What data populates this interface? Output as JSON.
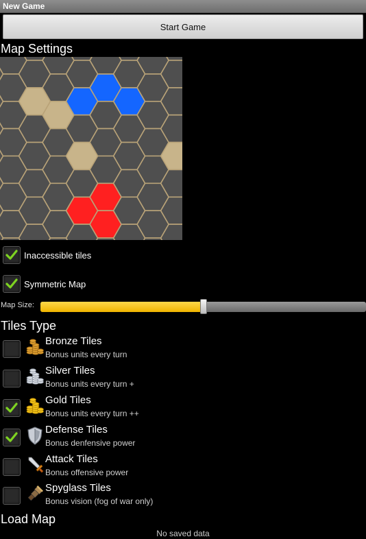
{
  "window": {
    "title": "New Game"
  },
  "start_button": {
    "label": "Start Game"
  },
  "map_settings": {
    "heading": "Map Settings",
    "colors": {
      "empty": "#4f4f4f",
      "grid": "#b9a378",
      "sand": "#c8b48a",
      "blue": "#1466ff",
      "red": "#ff2020"
    }
  },
  "options": [
    {
      "label": "Inaccessible tiles",
      "checked": true
    },
    {
      "label": "Symmetric Map",
      "checked": true
    }
  ],
  "map_size": {
    "label": "Map Size:",
    "value": 0.5
  },
  "tiles_type": {
    "heading": "Tiles Type",
    "items": [
      {
        "name": "Bronze Tiles",
        "description": "Bonus units every turn",
        "icon": "bronze-coins-icon",
        "checked": false
      },
      {
        "name": "Silver Tiles",
        "description": "Bonus units every turn +",
        "icon": "silver-coins-icon",
        "checked": false
      },
      {
        "name": "Gold Tiles",
        "description": "Bonus units every turn ++",
        "icon": "gold-coins-icon",
        "checked": true
      },
      {
        "name": "Defense Tiles",
        "description": "Bonus denfensive power",
        "icon": "shield-icon",
        "checked": true
      },
      {
        "name": "Attack Tiles",
        "description": "Bonus offensive power",
        "icon": "sword-icon",
        "checked": false
      },
      {
        "name": "Spyglass Tiles",
        "description": "Bonus vision (fog of war only)",
        "icon": "spyglass-icon",
        "checked": false
      }
    ]
  },
  "load_map": {
    "heading": "Load Map",
    "status": "No saved data"
  }
}
